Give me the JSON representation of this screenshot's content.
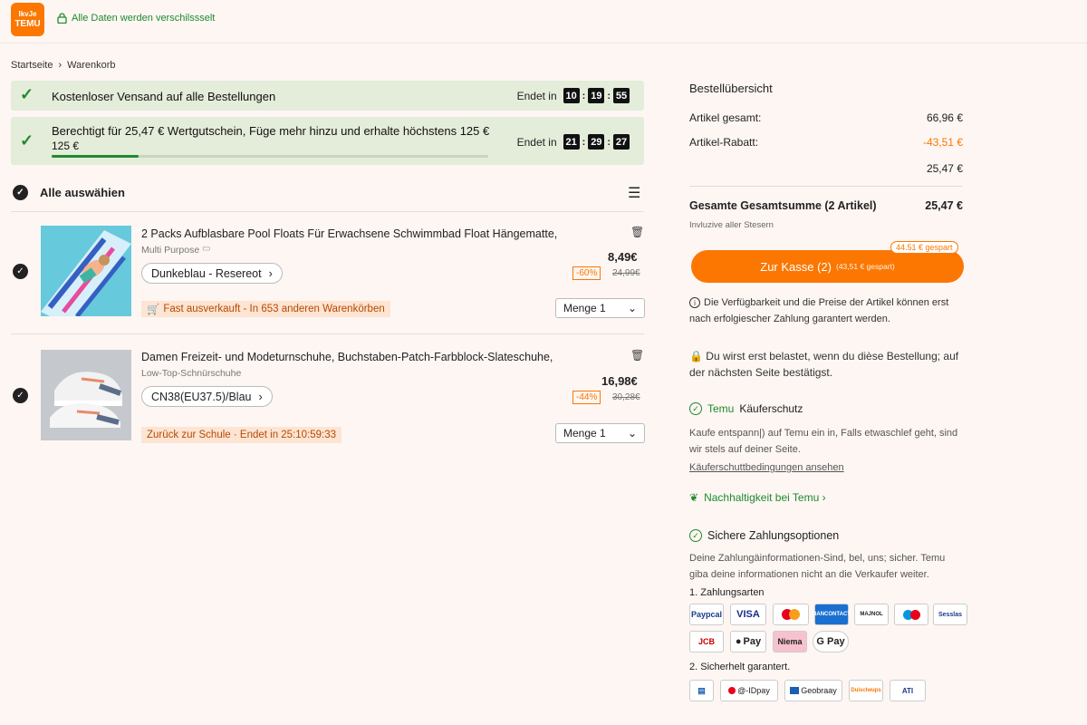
{
  "header": {
    "logo_line1": "IkvJe",
    "logo_line2": "TEMU",
    "secure_text": "Alle Daten werden verschilssselt"
  },
  "breadcrumb": {
    "home": "Startseite",
    "separator": "›",
    "current": "Warenkorb"
  },
  "banners": [
    {
      "text": "Kostenloser Vensand auf alle Bestellungen",
      "ends_label": "Endet in",
      "timer": [
        "10",
        "19",
        "55"
      ]
    },
    {
      "text_line1": "Berechtigt für 25,47 € Wertgutschein, Füge mehr hinzu und erhalte höchstens 125 €",
      "text_line2": "125 €",
      "ends_label": "Endet in",
      "timer": [
        "21",
        "29",
        "27"
      ],
      "progress": 0.2
    }
  ],
  "select_all": {
    "label": "Alle auswähien"
  },
  "items": [
    {
      "title": "2 Packs Aufblasbare Pool Floats Für Erwachsene Schwimmbad Float Hängematte,",
      "subtitle": "Multi Purpose",
      "variant": "Dunkeblau  -  Resereot",
      "price": "8,49€",
      "discount": "-60%",
      "old_price": "24,99€",
      "tag": "Fast ausverkauft - In 653 anderen Warenkörben",
      "quantity": "Menge 1"
    },
    {
      "title": "Damen Freizeit- und Modeturnschuhe, Buchstaben-Patch-Farbblock-Slateschuhe,",
      "subtitle": "Low-Top-Schnürschuhe",
      "variant": "CN38(EU37.5)/Blau",
      "price": "16,98€",
      "discount": "-44%",
      "old_price": "30,28€",
      "tag": "Zurück zur Schule · Endet in 25:10:59:33",
      "quantity": "Menge 1"
    }
  ],
  "summary": {
    "title": "Bestellübersicht",
    "rows": [
      {
        "label": "Artikel gesamt:",
        "value": "66,96 €"
      },
      {
        "label": "Artikel-Rabatt:",
        "value": "-43,51 €"
      },
      {
        "label": "",
        "value": "25,47 €"
      }
    ],
    "total_label": "Gesamte Gesamtsumme (2 Artikel)",
    "total_value": "25,47 €",
    "tax_note": "Invluzive aller Stesern",
    "checkout_label": "Zur Kasse (2)",
    "checkout_saved": "(43,51 € gespart)",
    "bubble": "44.51 € gespart",
    "availability_note": "Die Verfügbarkeit und die Preise der Artikel können erst nach erfolgiescher Zahlung garantert werden.",
    "charge_note": "Du wirst erst belastet, wenn du dièse Bestellung; auf der nächsten Seite bestätigst.",
    "protection_brand": "Temu",
    "protection_title": "Käuferschutz",
    "protection_text": "Kaufe entspann|) auf Temu ein in, Falls etwaschlef geht, sind wir stels auf deiner Seite.",
    "protection_link": "Käuferschuttbedingungen ansehen",
    "sustain_link": "Nachhaltigkeit bei Temu ›",
    "payment_title": "Sichere Zahlungsoptionen",
    "payment_text": "Deine Zahlungäinformationen-Sind, bel, uns; sicher. Temu giba deine informationen nicht an die Verkaufer weiter.",
    "payment_types_label": "1. Zahlungsarten",
    "payment_methods": [
      "Paypcal",
      "VISA",
      "",
      "BANCONTACT",
      "MAJNOL",
      "",
      "Sesslas",
      "JCB",
      "Pay",
      "Niema",
      "G Pay"
    ],
    "security_label": "2. Sicherhelt garantert.",
    "security_badges": [
      "",
      "@-IDpay",
      "Geobraay",
      "Duisclwups",
      "ATI"
    ]
  },
  "colors": {
    "accent": "#fb7701",
    "green": "#1f8a2e",
    "banner_bg": "#e4ecda",
    "page_bg": "#fdf6f3"
  }
}
